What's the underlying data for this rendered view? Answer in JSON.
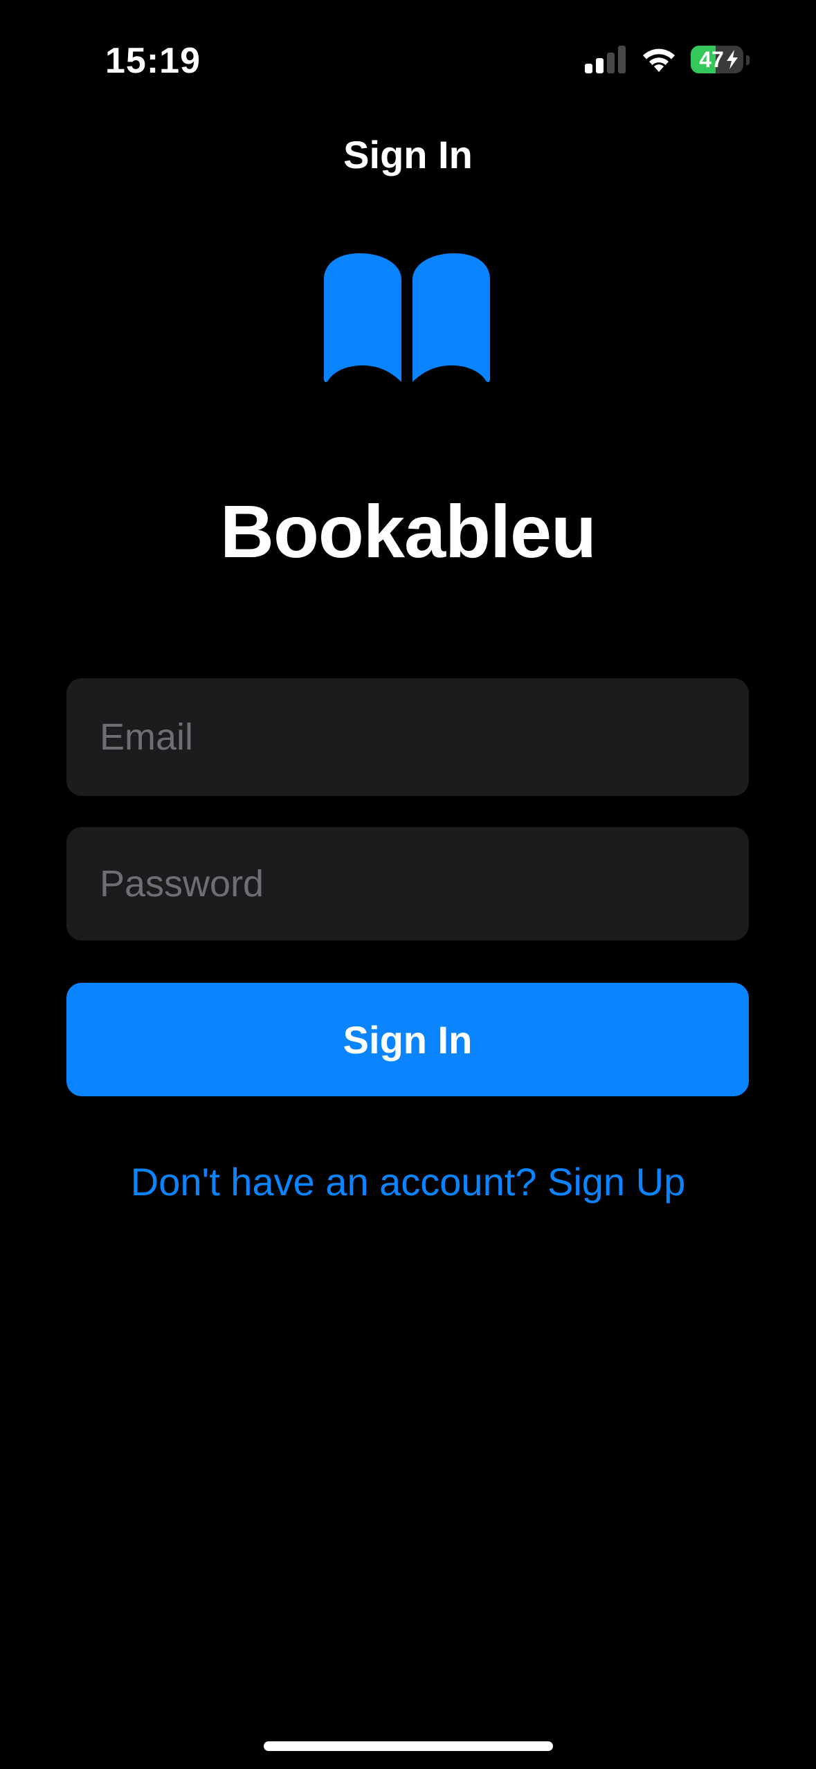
{
  "status_bar": {
    "time": "15:19",
    "battery_level": "47",
    "battery_fraction": 0.47,
    "signal_bars_active": 2,
    "signal_bars_total": 4,
    "charging": true
  },
  "nav": {
    "title": "Sign In"
  },
  "logo": {
    "icon": "book-icon",
    "color": "#0a84ff"
  },
  "app": {
    "name": "Bookableu"
  },
  "form": {
    "email_placeholder": "Email",
    "email_value": "",
    "password_placeholder": "Password",
    "password_value": "",
    "submit_label": "Sign In",
    "signup_link": "Don't have an account? Sign Up"
  },
  "colors": {
    "accent": "#0a84ff",
    "background": "#000000",
    "field_background": "#1c1c1e",
    "placeholder": "#6e6e73",
    "battery_green": "#34c759"
  }
}
